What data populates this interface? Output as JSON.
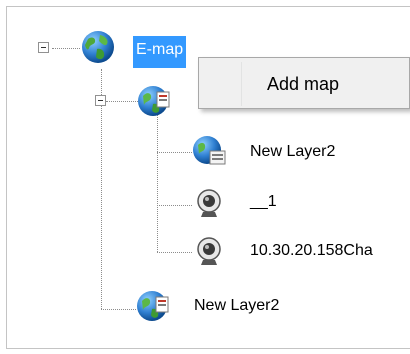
{
  "tree": {
    "root": {
      "label": "E-map",
      "icon": "globe-icon"
    },
    "child": {
      "icon": "globe-map-icon"
    },
    "items": [
      {
        "label": "New Layer2",
        "icon": "layer-map-icon"
      },
      {
        "label": "__1",
        "icon": "webcam-icon"
      },
      {
        "label": "10.30.20.158Cha",
        "icon": "webcam-icon"
      }
    ],
    "sibling": {
      "label": "New Layer2",
      "icon": "globe-map-icon"
    }
  },
  "context_menu": {
    "items": [
      {
        "label": "Add map"
      }
    ]
  },
  "colors": {
    "selection": "#3399ff",
    "menu_bg": "#f0f0f0"
  }
}
